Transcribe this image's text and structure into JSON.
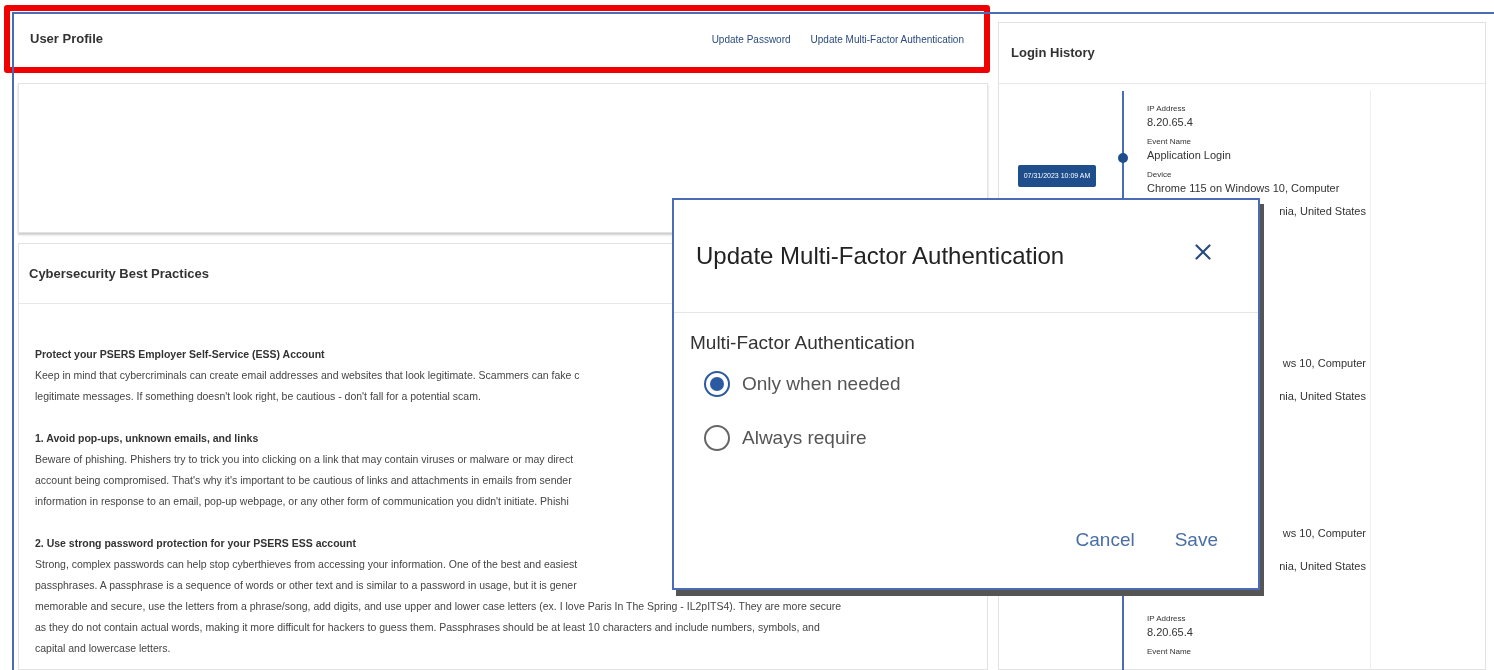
{
  "page_header": {
    "title": "User Profile",
    "highlighted": true,
    "links": [
      "Update Password",
      "Update Multi-Factor Authentication"
    ]
  },
  "cybersecurity": {
    "title": "Cybersecurity Best Practices",
    "sections": [
      {
        "heading": "Protect your PSERS Employer Self-Service (ESS) Account",
        "lines": [
          "Keep in mind that cybercriminals can create email addresses and websites that look legitimate. Scammers can fake c",
          "legitimate messages. If something doesn't look right, be cautious - don't fall for a potential scam."
        ]
      },
      {
        "heading": "1. Avoid pop-ups, unknown emails, and links",
        "lines": [
          "Beware of phishing. Phishers try to trick you into clicking on a link that may contain viruses or malware or may direct",
          "account being compromised. That's why it's important to be cautious of links and attachments in emails from sender",
          "information in response to an email, pop-up webpage, or any other form of communication you didn't initiate. Phishi"
        ]
      },
      {
        "heading": "2. Use strong password protection for your PSERS ESS account",
        "lines": [
          "Strong, complex passwords can help stop cyberthieves from accessing your information. One of the best and easiest",
          "passphrases. A passphrase is a sequence of words or other text and is similar to a password in usage, but it is gener",
          "memorable and secure, use the letters from a phrase/song, add digits, and use upper and lower case letters (ex. I love Paris In The Spring - IL2pITS4). They are more secure",
          "as they do not contain actual words, making it more difficult for hackers to guess them. Passphrases should be at least 10 characters and include numbers, symbols, and",
          "capital and lowercase letters."
        ]
      }
    ]
  },
  "login_history": {
    "title": "Login History",
    "entries": [
      {
        "covered": false,
        "timestamp": "07/31/2023 10:09 AM",
        "fields": [
          {
            "label": "IP Address",
            "value": "8.20.65.4"
          },
          {
            "label": "Event Name",
            "value": "Application Login"
          },
          {
            "label": "Device",
            "value": "Chrome 115 on Windows 10, Computer"
          },
          {
            "value": "nia, United States"
          }
        ]
      },
      {
        "covered": true,
        "fields": [
          {
            "value": "ws 10, Computer"
          },
          {
            "value": "nia, United States"
          }
        ]
      },
      {
        "covered": true,
        "fields": [
          {
            "value": "ws 10, Computer"
          },
          {
            "value": "nia, United States"
          }
        ]
      },
      {
        "covered": false,
        "fields": [
          {
            "label": "IP Address",
            "value": "8.20.65.4"
          },
          {
            "label": "Event Name"
          }
        ]
      }
    ]
  },
  "dialog": {
    "title": "Update Multi-Factor Authentication",
    "group_label": "Multi-Factor Authentication",
    "options": [
      {
        "label": "Only when needed",
        "selected": true
      },
      {
        "label": "Always require",
        "selected": false
      }
    ],
    "buttons": [
      "Cancel",
      "Save"
    ]
  }
}
